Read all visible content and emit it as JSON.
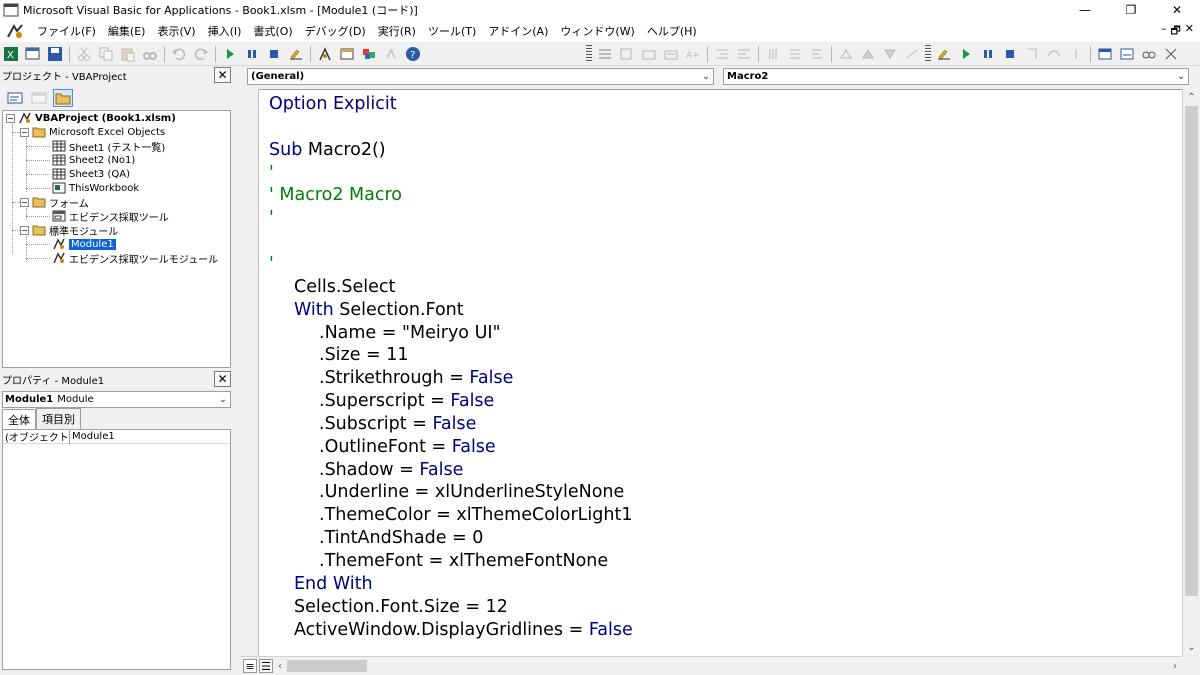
{
  "window": {
    "title": "Microsoft Visual Basic for Applications - Book1.xlsm - [Module1 (コード)]",
    "minimize": "—",
    "restore": "❐",
    "close": "✕",
    "mdi_minimize": "–",
    "mdi_restore": "🗗",
    "mdi_close": "✕"
  },
  "menu": [
    "ファイル(F)",
    "編集(E)",
    "表示(V)",
    "挿入(I)",
    "書式(O)",
    "デバッグ(D)",
    "実行(R)",
    "ツール(T)",
    "アドイン(A)",
    "ウィンドウ(W)",
    "ヘルプ(H)"
  ],
  "project": {
    "header": "プロジェクト - VBAProject",
    "root": "VBAProject (Book1.xlsm)",
    "excel_objects": "Microsoft Excel Objects",
    "sheets": [
      "Sheet1 (テスト一覧)",
      "Sheet2 (No1)",
      "Sheet3 (QA)",
      "ThisWorkbook"
    ],
    "forms_folder": "フォーム",
    "forms": [
      "エビデンス採取ツール"
    ],
    "modules_folder": "標準モジュール",
    "modules": [
      "Module1",
      "エビデンス採取ツールモジュール"
    ]
  },
  "properties": {
    "header": "プロパティ - Module1",
    "object_name": "Module1",
    "object_type": "Module",
    "tabs": [
      "全体",
      "項目別"
    ],
    "row_key": "(オブジェクト名)",
    "row_value": "Module1"
  },
  "code": {
    "object_combo": "(General)",
    "proc_combo": "Macro2",
    "lines": [
      {
        "indent": 0,
        "parts": [
          {
            "t": "Option Explicit",
            "c": "kw"
          }
        ]
      },
      {
        "indent": 0,
        "parts": []
      },
      {
        "indent": 0,
        "parts": [
          {
            "t": "Sub",
            "c": "kw"
          },
          {
            "t": " Macro2()",
            "c": ""
          }
        ]
      },
      {
        "indent": 0,
        "parts": [
          {
            "t": "'",
            "c": "cm"
          }
        ]
      },
      {
        "indent": 0,
        "parts": [
          {
            "t": "' Macro2 Macro",
            "c": "cm"
          }
        ]
      },
      {
        "indent": 0,
        "parts": [
          {
            "t": "'",
            "c": "cm"
          }
        ]
      },
      {
        "indent": 0,
        "parts": []
      },
      {
        "indent": 0,
        "parts": [
          {
            "t": "'",
            "c": "cm"
          }
        ]
      },
      {
        "indent": 1,
        "parts": [
          {
            "t": "Cells.Select",
            "c": ""
          }
        ]
      },
      {
        "indent": 1,
        "parts": [
          {
            "t": "With",
            "c": "kw"
          },
          {
            "t": " Selection.Font",
            "c": ""
          }
        ]
      },
      {
        "indent": 2,
        "parts": [
          {
            "t": ".Name = \"Meiryo UI\"",
            "c": ""
          }
        ]
      },
      {
        "indent": 2,
        "parts": [
          {
            "t": ".Size = 11",
            "c": ""
          }
        ]
      },
      {
        "indent": 2,
        "parts": [
          {
            "t": ".Strikethrough = ",
            "c": ""
          },
          {
            "t": "False",
            "c": "kw"
          }
        ]
      },
      {
        "indent": 2,
        "parts": [
          {
            "t": ".Superscript = ",
            "c": ""
          },
          {
            "t": "False",
            "c": "kw"
          }
        ]
      },
      {
        "indent": 2,
        "parts": [
          {
            "t": ".Subscript = ",
            "c": ""
          },
          {
            "t": "False",
            "c": "kw"
          }
        ]
      },
      {
        "indent": 2,
        "parts": [
          {
            "t": ".OutlineFont = ",
            "c": ""
          },
          {
            "t": "False",
            "c": "kw"
          }
        ]
      },
      {
        "indent": 2,
        "parts": [
          {
            "t": ".Shadow = ",
            "c": ""
          },
          {
            "t": "False",
            "c": "kw"
          }
        ]
      },
      {
        "indent": 2,
        "parts": [
          {
            "t": ".Underline = xlUnderlineStyleNone",
            "c": ""
          }
        ]
      },
      {
        "indent": 2,
        "parts": [
          {
            "t": ".ThemeColor = xlThemeColorLight1",
            "c": ""
          }
        ]
      },
      {
        "indent": 2,
        "parts": [
          {
            "t": ".TintAndShade = 0",
            "c": ""
          }
        ]
      },
      {
        "indent": 2,
        "parts": [
          {
            "t": ".ThemeFont = xlThemeFontNone",
            "c": ""
          }
        ]
      },
      {
        "indent": 1,
        "parts": [
          {
            "t": "End With",
            "c": "kw"
          }
        ]
      },
      {
        "indent": 1,
        "parts": [
          {
            "t": "Selection.Font.Size = 12",
            "c": ""
          }
        ]
      },
      {
        "indent": 1,
        "parts": [
          {
            "t": "ActiveWindow.DisplayGridlines = ",
            "c": ""
          },
          {
            "t": "False",
            "c": "kw"
          }
        ]
      }
    ]
  },
  "colors": {
    "keyword": "#00007f",
    "comment": "#008000",
    "selection": "#0a64d8"
  }
}
